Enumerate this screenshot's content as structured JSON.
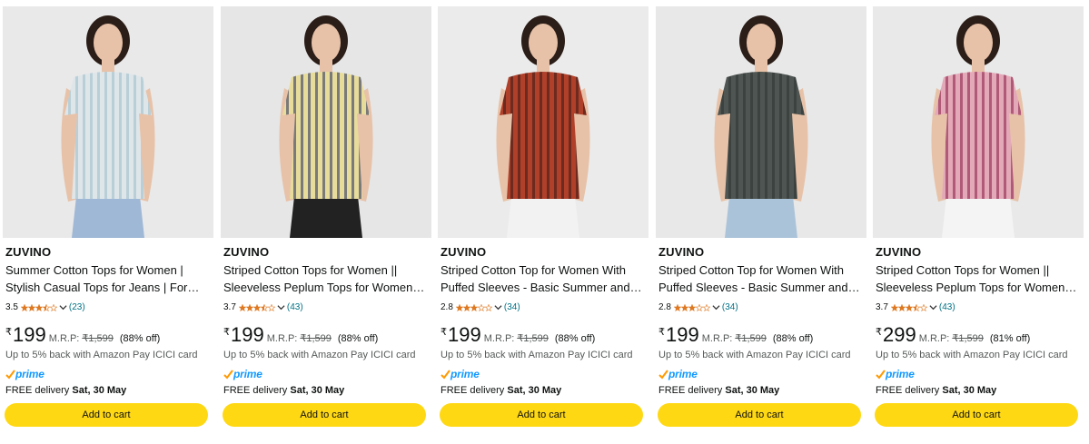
{
  "products": [
    {
      "brand": "ZUVINO",
      "title_line1": "Summer Cotton Tops for Women |",
      "title_line2": "Stylish Casual Tops for Jeans | Form…",
      "rating": "3.5",
      "stars": 3.5,
      "count": "(23)",
      "currency": "₹",
      "price": "199",
      "mrp_label": "M.R.P:",
      "mrp": "₹1,599",
      "discount": "(88% off)",
      "cashback": "Up to 5% back with Amazon Pay ICICI card",
      "prime": "prime",
      "delivery_label": "FREE delivery",
      "delivery_date": "Sat, 30 May",
      "cart_label": "Add to cart",
      "colors": {
        "top": "#dfe6ea",
        "stripe": "#b9cfd8",
        "bottom": "#9fb8d6",
        "bg": "#e9e9e9"
      }
    },
    {
      "brand": "ZUVINO",
      "title_line1": "Striped Cotton Tops for Women ||",
      "title_line2": "Sleeveless Peplum Tops for Women …",
      "rating": "3.7",
      "stars": 3.5,
      "count": "(43)",
      "currency": "₹",
      "price": "199",
      "mrp_label": "M.R.P:",
      "mrp": "₹1,599",
      "discount": "(88% off)",
      "cashback": "Up to 5% back with Amazon Pay ICICI card",
      "prime": "prime",
      "delivery_label": "FREE delivery",
      "delivery_date": "Sat, 30 May",
      "cart_label": "Add to cart",
      "colors": {
        "top": "#e8dc9a",
        "stripe": "#7a7a7a",
        "bottom": "#222222",
        "bg": "#e6e6e6"
      }
    },
    {
      "brand": "ZUVINO",
      "title_line1": "Striped Cotton Top for Women With",
      "title_line2": "Puffed Sleeves - Basic Summer and…",
      "rating": "2.8",
      "stars": 3,
      "count": "(34)",
      "currency": "₹",
      "price": "199",
      "mrp_label": "M.R.P:",
      "mrp": "₹1,599",
      "discount": "(88% off)",
      "cashback": "Up to 5% back with Amazon Pay ICICI card",
      "prime": "prime",
      "delivery_label": "FREE delivery",
      "delivery_date": "Sat, 30 May",
      "cart_label": "Add to cart",
      "colors": {
        "top": "#b0402a",
        "stripe": "#6d2a1e",
        "bottom": "#f2f2f2",
        "bg": "#ebebeb"
      }
    },
    {
      "brand": "ZUVINO",
      "title_line1": "Striped Cotton Top for Women With",
      "title_line2": "Puffed Sleeves - Basic Summer and…",
      "rating": "2.8",
      "stars": 3,
      "count": "(34)",
      "currency": "₹",
      "price": "199",
      "mrp_label": "M.R.P:",
      "mrp": "₹1,599",
      "discount": "(88% off)",
      "cashback": "Up to 5% back with Amazon Pay ICICI card",
      "prime": "prime",
      "delivery_label": "FREE delivery",
      "delivery_date": "Sat, 30 May",
      "cart_label": "Add to cart",
      "colors": {
        "top": "#4f5552",
        "stripe": "#3c423f",
        "bottom": "#aac3d9",
        "bg": "#e8e8e8"
      }
    },
    {
      "brand": "ZUVINO",
      "title_line1": "Striped Cotton Tops for Women ||",
      "title_line2": "Sleeveless Peplum Tops for Women …",
      "rating": "3.7",
      "stars": 3.5,
      "count": "(43)",
      "currency": "₹",
      "price": "299",
      "mrp_label": "M.R.P:",
      "mrp": "₹1,599",
      "discount": "(81% off)",
      "cashback": "Up to 5% back with Amazon Pay ICICI card",
      "prime": "prime",
      "delivery_label": "FREE delivery",
      "delivery_date": "Sat, 30 May",
      "cart_label": "Add to cart",
      "colors": {
        "top": "#e3a9b8",
        "stripe": "#b05a78",
        "bottom": "#f4f4f4",
        "bg": "#e9e9e9"
      }
    }
  ],
  "theme": {
    "button": "#ffd814",
    "link": "#007185",
    "star": "#de7921",
    "prime": "#1399ff",
    "check": "#ff9900"
  }
}
